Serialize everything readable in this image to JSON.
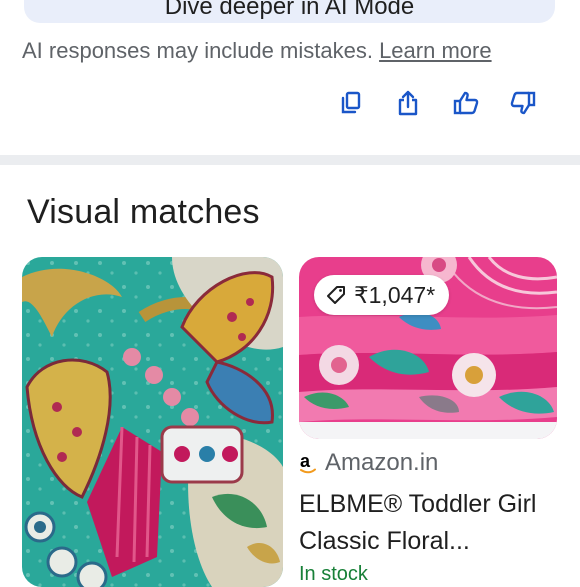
{
  "ai_mode": {
    "button_label": "Dive deeper in AI Mode"
  },
  "disclaimer": {
    "text": "AI responses may include mistakes.",
    "link_label": "Learn more"
  },
  "feedback_actions": {
    "icons": [
      "copy-icon",
      "share-icon",
      "thumbs-up-icon",
      "thumbs-down-icon"
    ],
    "icon_color": "#1a56c8"
  },
  "visual_matches": {
    "title": "Visual matches",
    "items": [
      {
        "image": "textile-butterfly-teal"
      },
      {
        "image": "pink-floral-fabric",
        "price": "₹1,047*",
        "source": "Amazon.in",
        "title_line1": "ELBME® Toddler Girl",
        "title_line2": "Classic Floral...",
        "stock": "In stock"
      }
    ]
  },
  "colors": {
    "link": "#5f6368",
    "stock_green": "#188038",
    "divider": "#ebedf0",
    "ai_button_bg": "#e9eefa"
  }
}
